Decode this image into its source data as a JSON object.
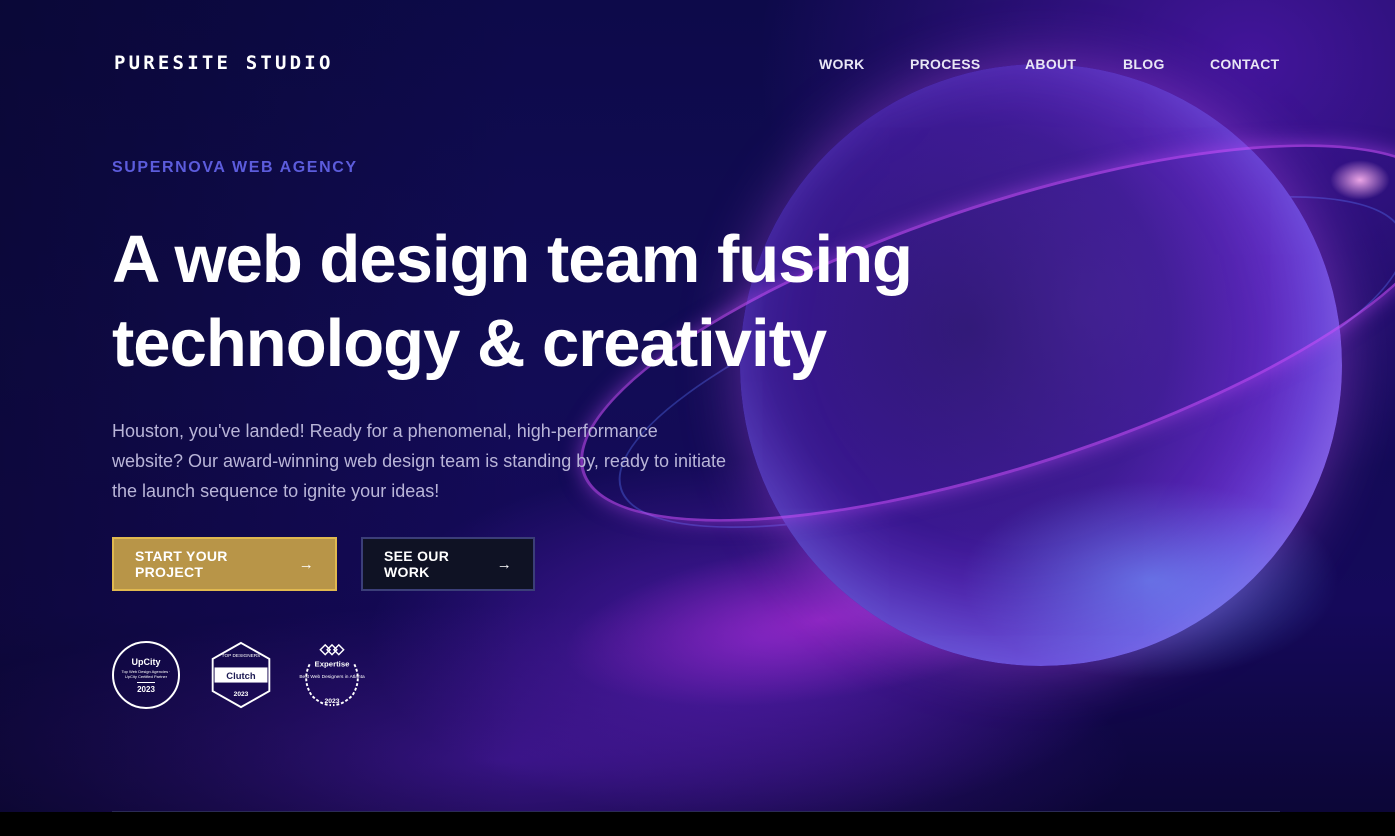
{
  "header": {
    "logo": "PURESITE STUDIO",
    "nav": [
      {
        "label": "WORK"
      },
      {
        "label": "PROCESS"
      },
      {
        "label": "ABOUT"
      },
      {
        "label": "BLOG"
      },
      {
        "label": "CONTACT"
      }
    ]
  },
  "hero": {
    "eyebrow": "SUPERNOVA WEB AGENCY",
    "headline_line1": "A web design team fusing",
    "headline_line2": "technology & creativity",
    "lede": "Houston, you've landed! Ready for a phenomenal, high-performance website? Our award-winning web design team is standing by, ready to initiate the launch sequence to ignite your ideas!",
    "primary_cta": "START YOUR PROJECT",
    "secondary_cta": "SEE OUR WORK"
  },
  "badges": {
    "upcity": {
      "brand": "UpCity",
      "text": "Top Web Design Agencies · UpCity Certified Partner",
      "year": "2023"
    },
    "clutch": {
      "top": "TOP DESIGNERS",
      "brand": "Clutch",
      "year": "2023"
    },
    "expertise": {
      "brand": "Expertise",
      "text": "Best Web Designers in Atlanta",
      "year": "2023"
    }
  },
  "colors": {
    "accent_gold": "#b89548",
    "eyebrow_blue": "#5c5cdc",
    "background_navy": "#120c55"
  },
  "icons": [
    "arrow-right-icon",
    "upcity-badge-icon",
    "clutch-badge-icon",
    "expertise-badge-icon"
  ]
}
